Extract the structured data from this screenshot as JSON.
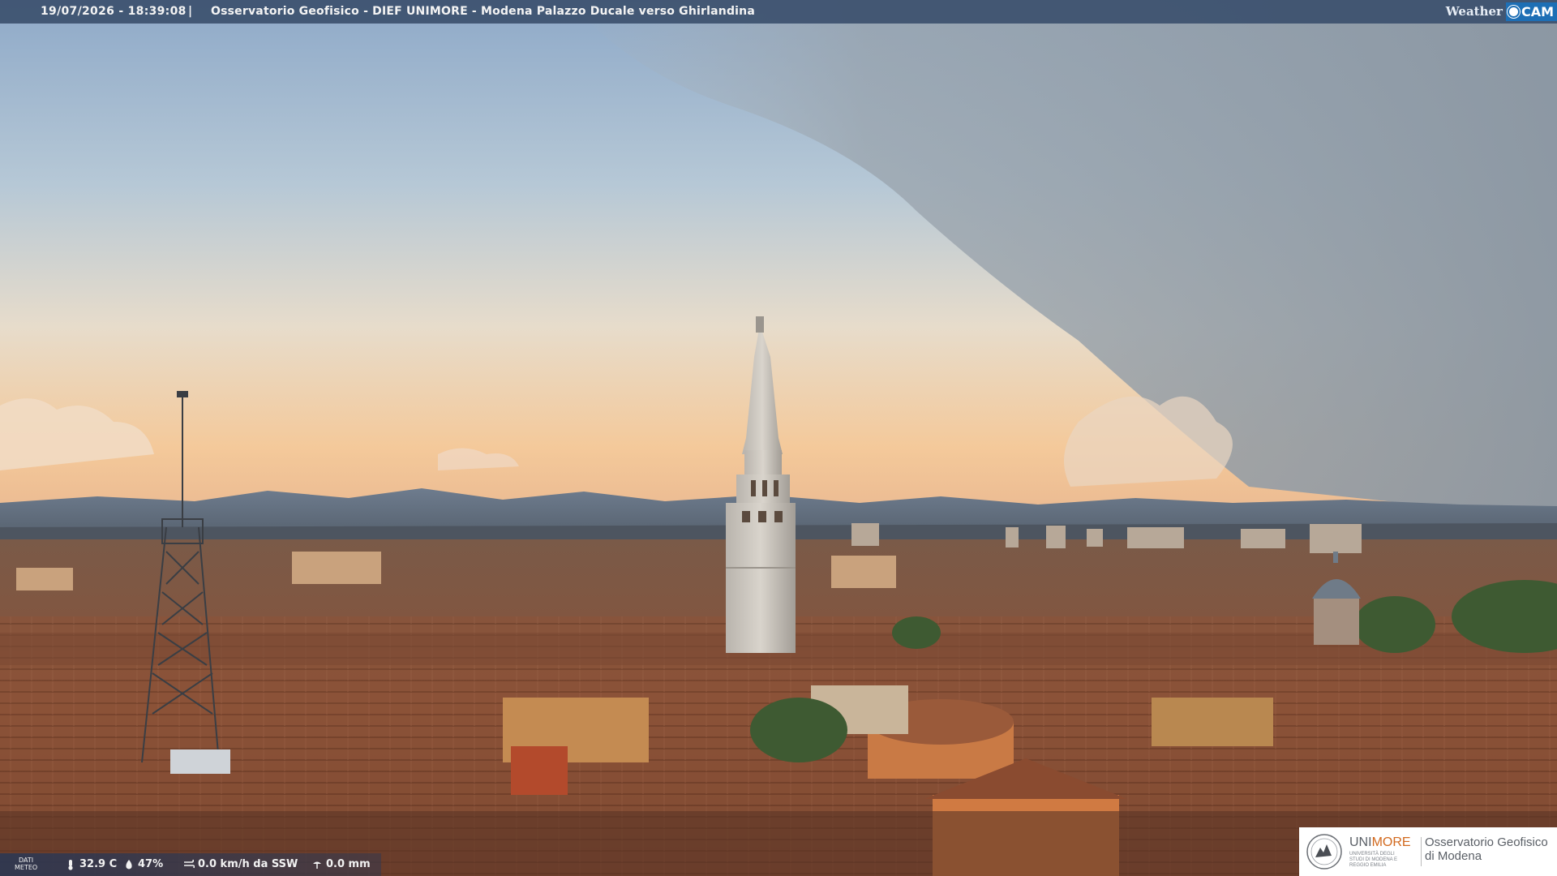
{
  "header": {
    "timestamp": "19/07/2026 - 18:39:08",
    "separator": "|",
    "title": "Osservatorio Geofisico - DIEF UNIMORE - Modena Palazzo Ducale verso Ghirlandina",
    "logo_weather": "Weather",
    "logo_cam": "CAM"
  },
  "meteo": {
    "label_line1": "DATI",
    "label_line2": "METEO",
    "temperature": "32.9 C",
    "humidity": "47%",
    "wind": "0.0 km/h da SSW",
    "rain": "0.0 mm",
    "icons": [
      "thermometer-icon",
      "humidity-icon",
      "wind-icon",
      "rain-gauge-icon"
    ]
  },
  "branding": {
    "unimore_prefix": "UNI",
    "unimore_suffix": "MORE",
    "unimore_sub": "UNIVERSITÀ DEGLI STUDI DI MODENA E REGGIO EMILIA",
    "observatory_line1": "Osservatorio Geofisico",
    "observatory_line2": "di Modena"
  },
  "colors": {
    "bar": "#3c506e",
    "unimore_accent": "#d2691e",
    "weathercam_blue": "#1e6fb5"
  }
}
